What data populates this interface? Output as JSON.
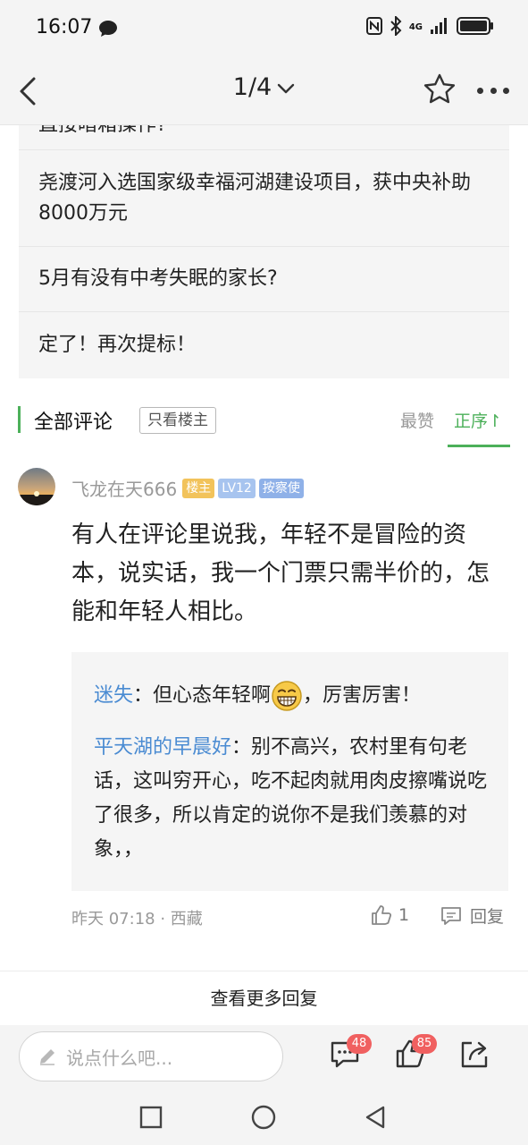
{
  "status_bar": {
    "time": "16:07",
    "network": "4G"
  },
  "header": {
    "page_indicator": "1/4"
  },
  "related_posts": [
    {
      "title": "直接暗箱操作?"
    },
    {
      "title": "尧渡河入选国家级幸福河湖建设项目，获中央补助8000万元"
    },
    {
      "title": "5月有没有中考失眠的家长?"
    },
    {
      "title": "定了！再次提标！"
    }
  ],
  "comments_section": {
    "title": "全部评论",
    "op_only_label": "只看楼主",
    "sort_best_label": "最赞",
    "sort_order_label": "正序↾",
    "accent_color": "#4cb05a"
  },
  "comment": {
    "username": "飞龙在天666",
    "badges": {
      "owner": "楼主",
      "level": "LV12",
      "role": "按察使"
    },
    "text": "有人在评论里说我，年轻不是冒险的资本，说实话，我一个门票只需半价的，怎能和年轻人相比。",
    "replies": [
      {
        "name": "迷失",
        "sep": "：",
        "text_before": "但心态年轻啊",
        "emoji": "grinning-emoji",
        "text_after": "，厉害厉害！"
      },
      {
        "name": "平天湖的早晨好",
        "sep": "：",
        "text": "别不高兴，农村里有句老话，这叫穷开心，吃不起肉就用肉皮擦嘴说吃了很多，所以肯定的说你不是我们羡慕的对象，，"
      }
    ],
    "meta": "昨天 07:18 · 西藏",
    "like_count": "1",
    "reply_label": "回复",
    "reply_name_color": "#4a8bd2"
  },
  "more_replies_label": "查看更多回复",
  "bottom_bar": {
    "input_placeholder": "说点什么吧...",
    "comment_count": "48",
    "like_count": "85",
    "badge_color": "#f06060"
  }
}
